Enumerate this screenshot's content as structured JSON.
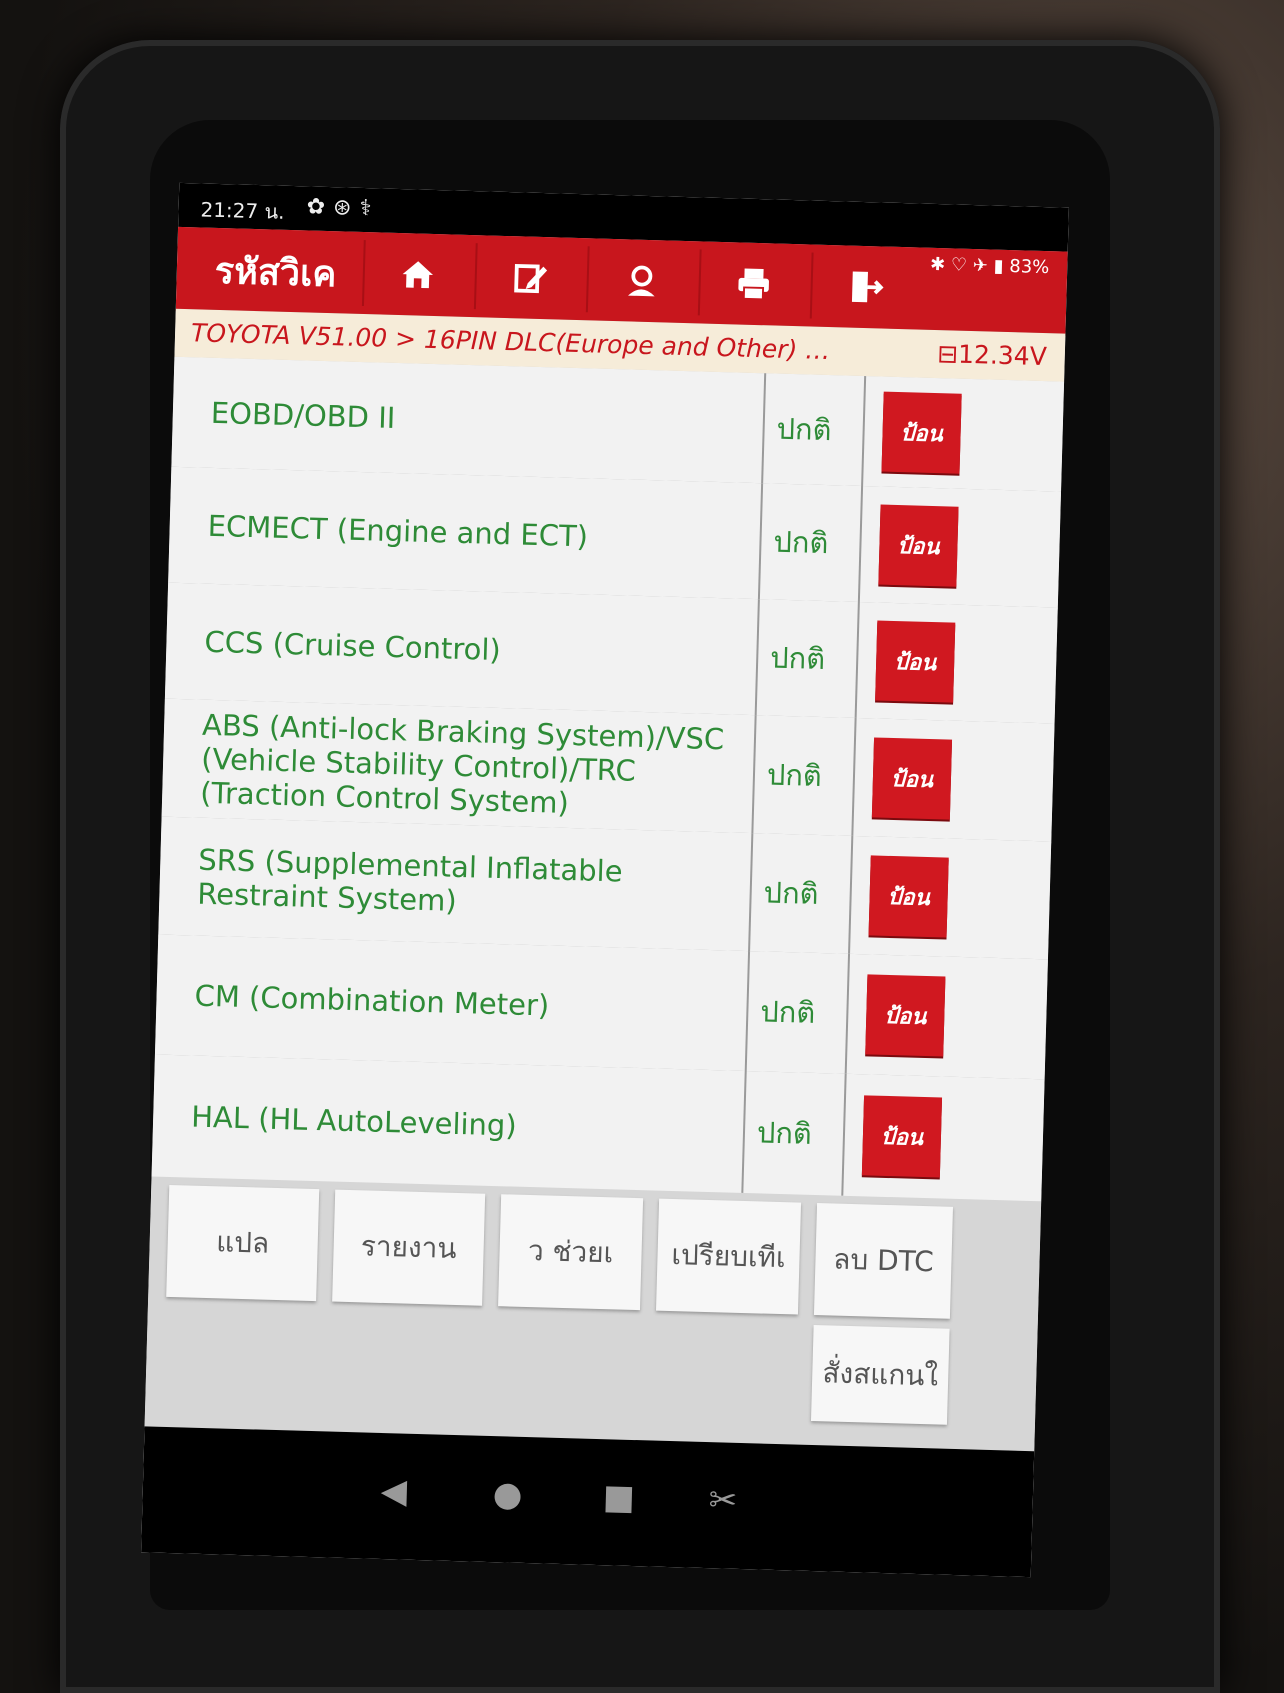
{
  "status_bar": {
    "time": "21:27 น.",
    "battery": "83%"
  },
  "header": {
    "title": "รหัสวิเค"
  },
  "breadcrumb": {
    "path": "TOYOTA V51.00 > 16PIN DLC(Europe and Other) > F...",
    "voltage": "12.34V"
  },
  "systems": [
    {
      "name": "EOBD/OBD II",
      "status": "ปกติ",
      "action": "ป้อน"
    },
    {
      "name": "ECMECT (Engine and ECT)",
      "status": "ปกติ",
      "action": "ป้อน"
    },
    {
      "name": "CCS (Cruise Control)",
      "status": "ปกติ",
      "action": "ป้อน"
    },
    {
      "name": "ABS (Anti-lock Braking System)/VSC (Vehicle Stability Control)/TRC (Traction Control System)",
      "status": "ปกติ",
      "action": "ป้อน"
    },
    {
      "name": "SRS (Supplemental Inflatable Restraint System)",
      "status": "ปกติ",
      "action": "ป้อน"
    },
    {
      "name": "CM (Combination Meter)",
      "status": "ปกติ",
      "action": "ป้อน"
    },
    {
      "name": "HAL (HL AutoLeveling)",
      "status": "ปกติ",
      "action": "ป้อน"
    }
  ],
  "footer_buttons": {
    "translate": "แปล",
    "report": "รายงาน",
    "help": "ว ช่วยเ",
    "compare": "เปรียบเทีเ",
    "clear_dtc": "ลบ DTC",
    "scan": "สั่งสแกนใ"
  },
  "icons": {
    "home": "home-icon",
    "edit": "edit-icon",
    "support": "support-icon",
    "print": "print-icon",
    "exit": "exit-icon"
  },
  "colors": {
    "header": "#c8161d",
    "status_text": "#2e8b37",
    "breadcrumb_bg": "#f6ecd9"
  }
}
